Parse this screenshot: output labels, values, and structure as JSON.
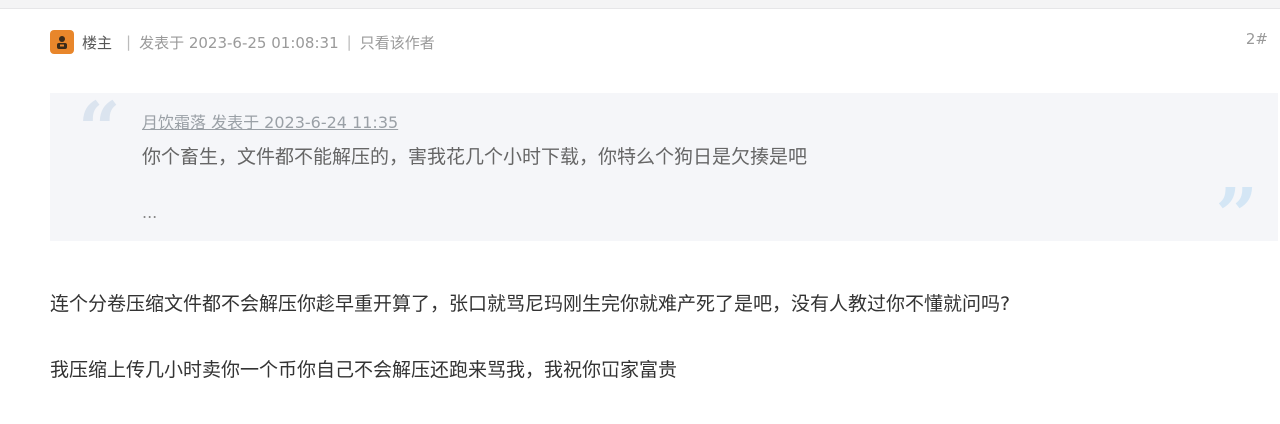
{
  "post": {
    "author_label": "楼主",
    "separator": "|",
    "posted_at": "发表于 2023-6-25 01:08:31",
    "only_author_link": "只看该作者",
    "floor": "2#"
  },
  "quote": {
    "meta": "月饮霜落 发表于 2023-6-24 11:35",
    "text": "你个畜生，文件都不能解压的，害我花几个小时下载，你特么个狗日是欠揍是吧",
    "ellipsis": "..."
  },
  "body": {
    "lines": [
      "连个分卷压缩文件都不会解压你趁早重开算了，张口就骂尼玛刚生完你就难产死了是吧，没有人教过你不懂就问吗?",
      "我压缩上传几小时卖你一个币你自己不会解压还跑来骂我，我祝你冚家富贵"
    ]
  },
  "icons": {
    "avatar": "user-avatar-icon",
    "quote_open": "open-quote-icon",
    "quote_close": "close-quote-icon"
  },
  "colors": {
    "avatar_bg": "#e8862b",
    "quote_bg": "#f5f6f9",
    "quote_mark": "#d4e6f5"
  }
}
